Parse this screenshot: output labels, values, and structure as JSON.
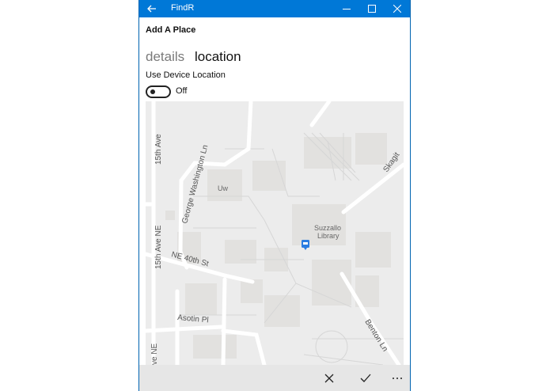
{
  "window": {
    "title": "FindR"
  },
  "page": {
    "title": "Add A Place"
  },
  "tabs": [
    {
      "label": "details",
      "active": false
    },
    {
      "label": "location",
      "active": true
    }
  ],
  "device_location": {
    "label": "Use Device Location",
    "state_label": "Off",
    "on": false
  },
  "map": {
    "labels": {
      "ave_15th_top": "15th Ave",
      "george_washington": "George Washington Ln",
      "uw": "Uw",
      "suzzallo_line1": "Suzzallo",
      "suzzallo_line2": "Library",
      "ave_15th_ne": "15th Ave NE",
      "ne_40th": "NE 40th St",
      "asotin": "Asotin Pl",
      "benton": "Benton Ln",
      "skagit": "Skagit",
      "ave_ne_bottom": "ve NE"
    },
    "pin_icon": "map-pin-icon"
  },
  "appbar": {
    "buttons": [
      "close-icon",
      "check-icon",
      "more-icon"
    ]
  },
  "colors": {
    "accent": "#0078d7",
    "map_bg": "#ececec",
    "road": "#ffffff",
    "appbar": "#e6e6e6"
  }
}
